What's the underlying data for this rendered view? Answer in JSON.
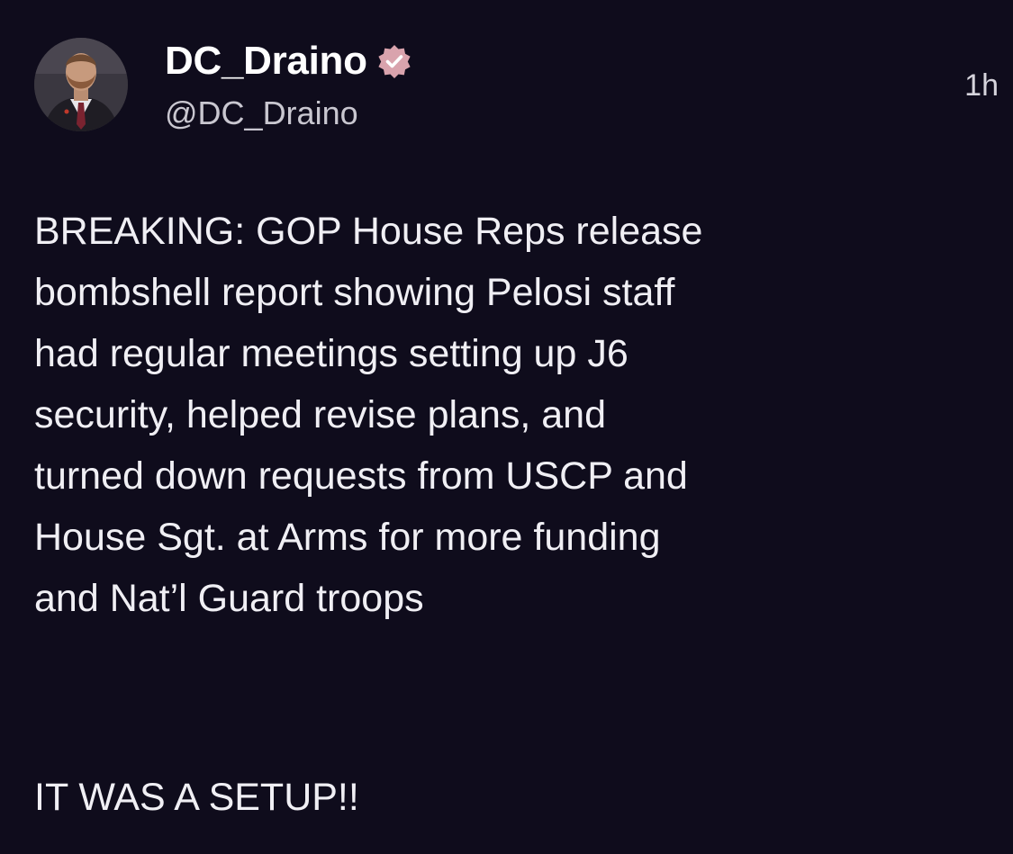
{
  "post": {
    "author": {
      "display_name": "DC_Draino",
      "handle": "@DC_Draino",
      "verified": true,
      "avatar_icon": "profile-photo"
    },
    "timestamp": "1h",
    "body_lines": [
      "BREAKING: GOP House Reps release",
      "bombshell report showing Pelosi staff",
      "had regular meetings setting up J6",
      "security, helped revise plans, and",
      "turned down requests from USCP and",
      "House Sgt. at Arms for more funding",
      "and Nat’l Guard troops"
    ],
    "closing_line": "IT WAS A SETUP!!"
  },
  "colors": {
    "background": "#0f0c1c",
    "text": "#f0eff4",
    "secondary_text": "#c9c7d0",
    "verified_badge": "#d9a3ad"
  }
}
